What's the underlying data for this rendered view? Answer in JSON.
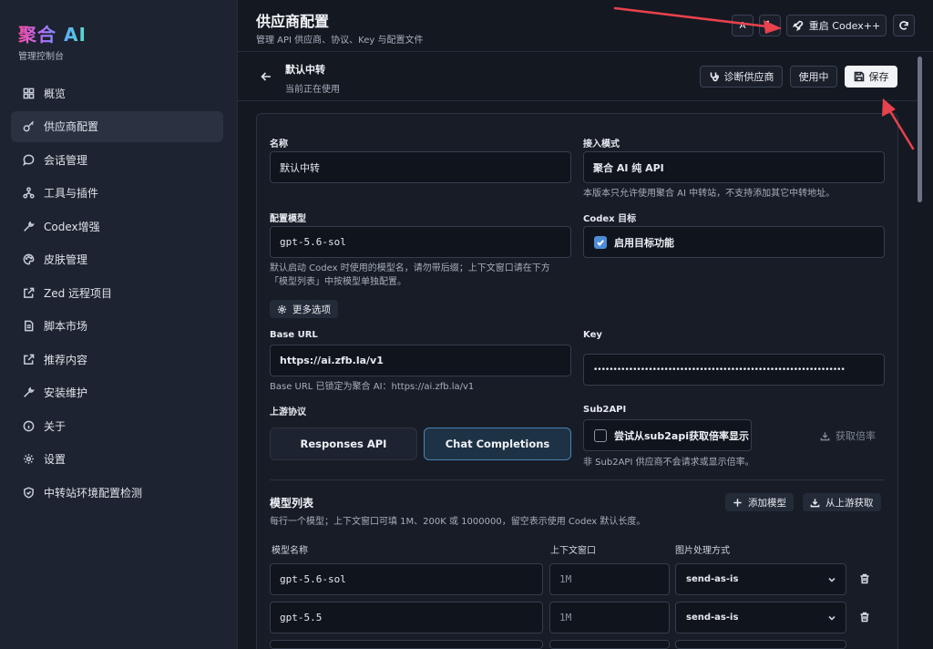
{
  "brand": {
    "name": "聚合 AI",
    "subtitle": "管理控制台"
  },
  "sidebar": {
    "items": [
      {
        "label": "概览",
        "icon": "grid-icon"
      },
      {
        "label": "供应商配置",
        "icon": "key-icon",
        "active": true
      },
      {
        "label": "会话管理",
        "icon": "chat-icon"
      },
      {
        "label": "工具与插件",
        "icon": "plugin-icon"
      },
      {
        "label": "Codex增强",
        "icon": "wrench-icon"
      },
      {
        "label": "皮肤管理",
        "icon": "palette-icon"
      },
      {
        "label": "Zed 远程项目",
        "icon": "external-link-icon"
      },
      {
        "label": "脚本市场",
        "icon": "script-icon"
      },
      {
        "label": "推荐内容",
        "icon": "external-link-icon"
      },
      {
        "label": "安装维护",
        "icon": "wrench-icon"
      },
      {
        "label": "关于",
        "icon": "info-icon"
      },
      {
        "label": "设置",
        "icon": "gear-icon"
      },
      {
        "label": "中转站环境配置检测",
        "icon": "shield-icon"
      }
    ]
  },
  "header": {
    "title": "供应商配置",
    "subtitle": "管理 API 供应商、协议、Key 与配置文件",
    "restart_label": "重启 Codex++"
  },
  "subheader": {
    "title": "默认中转",
    "subtitle": "当前正在使用",
    "diagnose_label": "诊断供应商",
    "in_use_label": "使用中",
    "save_label": "保存"
  },
  "form": {
    "name": {
      "label": "名称",
      "value": "默认中转"
    },
    "access_mode": {
      "label": "接入模式",
      "value": "聚合 AI 纯 API",
      "help": "本版本只允许使用聚合 AI 中转站，不支持添加其它中转地址。"
    },
    "model": {
      "label": "配置模型",
      "value": "gpt-5.6-sol",
      "help_line1": "默认启动 Codex 时使用的模型名，请勿带后缀；上下文窗口请在下方",
      "help_line2": "「模型列表」中按模型单独配置。"
    },
    "codex_target": {
      "label": "Codex 目标",
      "checkbox_label": "启用目标功能",
      "checked": true
    },
    "more_options_label": "更多选项",
    "base_url": {
      "label": "Base URL",
      "value": "https://ai.zfb.la/v1",
      "help": "Base URL 已锁定为聚合 AI：https://ai.zfb.la/v1"
    },
    "key": {
      "label": "Key",
      "value": "••••••••••••••••••••••••••••••••••••••••••••••••••••••••••••••••"
    },
    "upstream": {
      "label": "上游协议",
      "options": [
        "Responses API",
        "Chat Completions"
      ],
      "selected": "Chat Completions"
    },
    "sub2api": {
      "label": "Sub2API",
      "checkbox_label": "尝试从sub2api获取倍率显示",
      "checked": false,
      "fetch_label": "获取倍率",
      "help": "非 Sub2API 供应商不会请求或显示倍率。"
    }
  },
  "models": {
    "title": "模型列表",
    "help": "每行一个模型；上下文窗口可填 1M、200K 或 1000000，留空表示使用 Codex 默认长度。",
    "add_label": "添加模型",
    "fetch_label": "从上游获取",
    "columns": [
      "模型名称",
      "上下文窗口",
      "图片处理方式"
    ],
    "rows": [
      {
        "name": "gpt-5.6-sol",
        "context": "1M",
        "image": "send-as-is"
      },
      {
        "name": "gpt-5.5",
        "context": "1M",
        "image": "send-as-is"
      }
    ]
  },
  "colors": {
    "accent": "#4d8cd6",
    "background": "#141821",
    "sidebar": "#1d2330",
    "annotation_arrow": "#e8424d"
  }
}
